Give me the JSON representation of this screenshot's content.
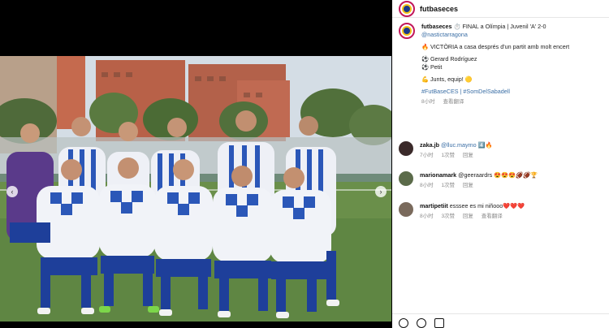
{
  "account": {
    "handle": "futbaseces"
  },
  "caption": {
    "line1_text": "⏱️ FINAL a Olímpia | Juvenil 'A' 2-0",
    "mention": "@nastictarragona",
    "victory": "🔥 VICTÒRIA a casa després d'un partit amb molt encert",
    "scorer1": "⚽ Gerard Rodríguez",
    "scorer2": "⚽ Petit",
    "together": "💪 Junts, equip! 🟡",
    "hashtags": "#FutBaseCES | #SomDelSabadell",
    "time": "8小时",
    "translate": "查看翻译"
  },
  "comments": [
    {
      "user": "zaka.jb",
      "text": "@lluc.maymo 4️⃣🔥",
      "time": "7小时",
      "likes": "1次赞",
      "reply": "回复"
    },
    {
      "user": "marionamark",
      "text": "@geeraardrs 😍😍😍🏈🏈🏆",
      "time": "8小时",
      "likes": "1次赞",
      "reply": "回复"
    },
    {
      "user": "martipetiit",
      "text": "esssee es mi niñooo❤️❤️❤️",
      "time": "8小时",
      "likes": "3次赞",
      "reply": "回复",
      "translate": "查看翻译"
    }
  ],
  "colors": {
    "accent_link": "#3a6ea5",
    "brand_ring": "#c2185b"
  }
}
